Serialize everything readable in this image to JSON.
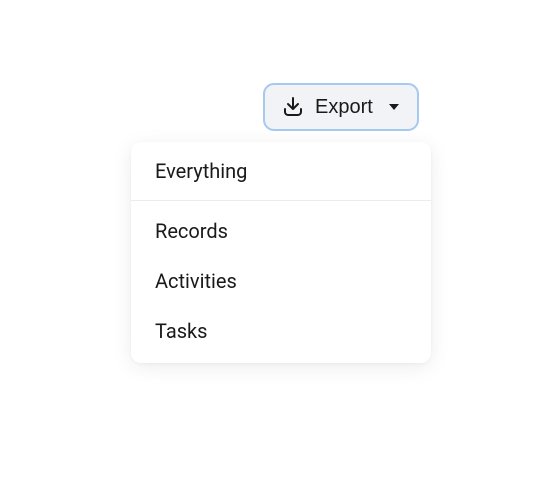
{
  "export_button": {
    "label": "Export"
  },
  "menu": {
    "everything": "Everything",
    "records": "Records",
    "activities": "Activities",
    "tasks": "Tasks"
  }
}
